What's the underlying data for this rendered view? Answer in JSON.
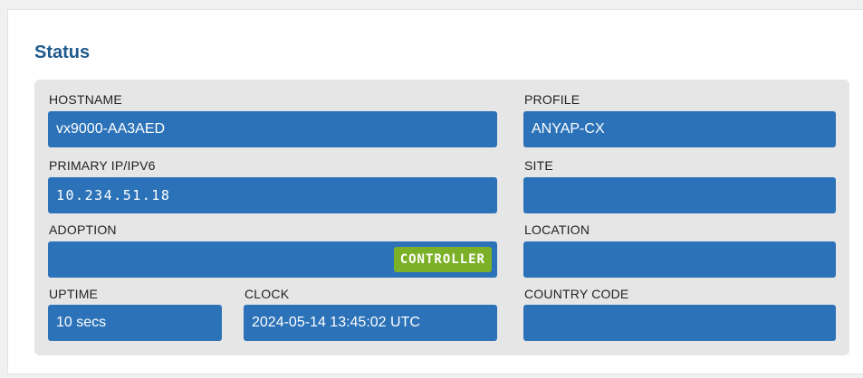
{
  "panel": {
    "title": "Status"
  },
  "status": {
    "hostname": {
      "label": "HOSTNAME",
      "value": "vx9000-AA3AED"
    },
    "profile": {
      "label": "PROFILE",
      "value": "ANYAP-CX"
    },
    "primary_ip": {
      "label": "PRIMARY IP/IPV6",
      "value": "10.234.51.18"
    },
    "site": {
      "label": "SITE",
      "value": ""
    },
    "adoption": {
      "label": "ADOPTION",
      "value": "",
      "badge": "CONTROLLER"
    },
    "location": {
      "label": "LOCATION",
      "value": ""
    },
    "uptime": {
      "label": "UPTIME",
      "value": "10 secs"
    },
    "clock": {
      "label": "CLOCK",
      "value": "2024-05-14 13:45:02 UTC"
    },
    "country_code": {
      "label": "COUNTRY CODE",
      "value": ""
    }
  },
  "colors": {
    "field_bg": "#2c72b8",
    "title": "#1f5a8c",
    "badge_bg": "#7cb127",
    "panel_bg": "#e6e6e6"
  }
}
